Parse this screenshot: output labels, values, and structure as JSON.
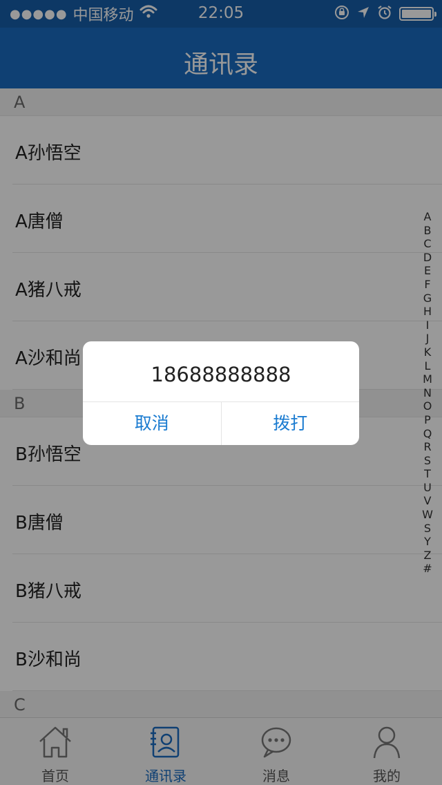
{
  "status_bar": {
    "signal": "●●●●●",
    "carrier": "中国移动",
    "time": "22:05",
    "battery_level": 1.0
  },
  "nav": {
    "title": "通讯录"
  },
  "sections": [
    {
      "letter": "A",
      "contacts": [
        "A孙悟空",
        "A唐僧",
        "A猪八戒",
        "A沙和尚"
      ]
    },
    {
      "letter": "B",
      "contacts": [
        "B孙悟空",
        "B唐僧",
        "B猪八戒",
        "B沙和尚"
      ]
    },
    {
      "letter": "C",
      "contacts": []
    }
  ],
  "index_letters": [
    "A",
    "B",
    "C",
    "D",
    "E",
    "F",
    "G",
    "H",
    "I",
    "J",
    "K",
    "L",
    "M",
    "N",
    "O",
    "P",
    "Q",
    "R",
    "S",
    "T",
    "U",
    "V",
    "W",
    "S",
    "Y",
    "Z",
    "#"
  ],
  "tabs": [
    {
      "label": "首页",
      "icon": "home-icon",
      "active": false
    },
    {
      "label": "通讯录",
      "icon": "contacts-icon",
      "active": true
    },
    {
      "label": "消息",
      "icon": "message-icon",
      "active": false
    },
    {
      "label": "我的",
      "icon": "profile-icon",
      "active": false
    }
  ],
  "dialog": {
    "phone_number": "18688888888",
    "cancel_label": "取消",
    "call_label": "拨打"
  },
  "colors": {
    "status_bar": "#175ea9",
    "nav_bar": "#1a6bc0",
    "accent": "#1a7bd0",
    "overlay": "rgba(0,0,0,0.4)"
  }
}
